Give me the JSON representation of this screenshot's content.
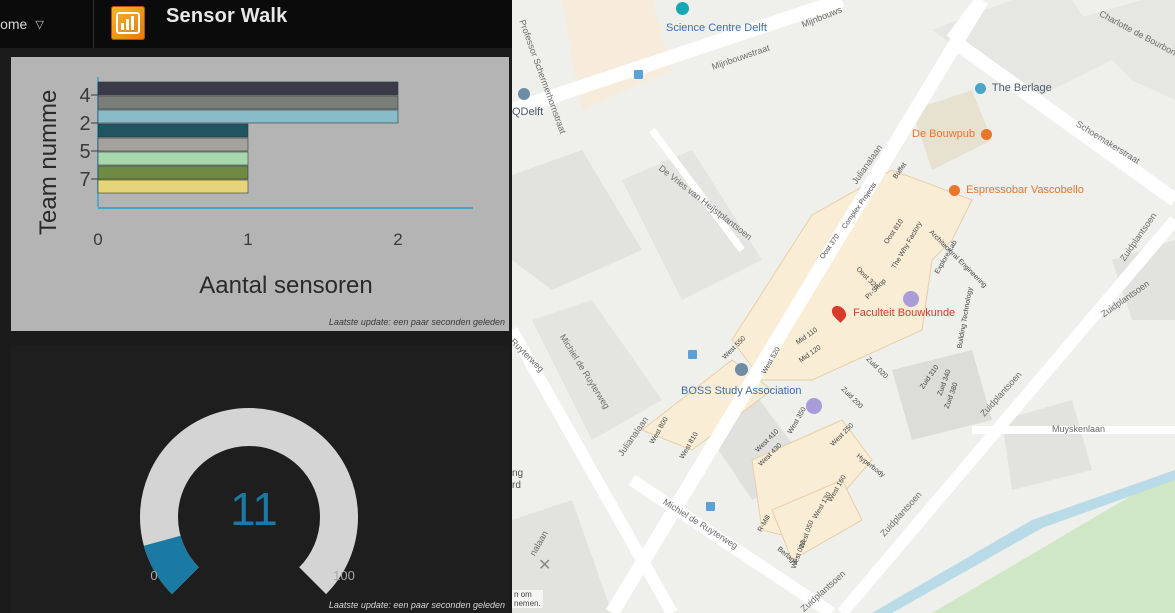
{
  "dashboard": {
    "home_label": "Home",
    "app_title": "Sensor Walk",
    "bar_chart": {
      "ylabel": "Team numme",
      "xlabel": "Aantal sensoren",
      "update_note": "Laatste update: een paar seconden geleden"
    },
    "gauge": {
      "value_text": "11",
      "min_label": "0",
      "max_label": "100",
      "update_note": "Laatste update: een paar seconden geleden"
    }
  },
  "chart_data": {
    "type": "bar",
    "orientation": "horizontal",
    "title": "",
    "xlabel": "Aantal sensoren",
    "ylabel": "Team numme",
    "xlim": [
      0,
      2.5
    ],
    "x_ticks": [
      "0",
      "1",
      "2"
    ],
    "y_tick_labels": [
      "4",
      "2",
      "5",
      "7"
    ],
    "bars": [
      {
        "value": 2,
        "color": "#3a3a48"
      },
      {
        "value": 2,
        "color": "#7a7e78"
      },
      {
        "value": 2,
        "color": "#88bcc9"
      },
      {
        "value": 1,
        "color": "#1f5461"
      },
      {
        "value": 1,
        "color": "#a4a29a"
      },
      {
        "value": 1,
        "color": "#a7d7ad"
      },
      {
        "value": 1,
        "color": "#6f8a42"
      },
      {
        "value": 1,
        "color": "#e6d47a"
      }
    ],
    "gauge_value": 11,
    "gauge_range": [
      0,
      100
    ],
    "gauge_color": "#1a7aa3"
  },
  "map": {
    "pois": {
      "science_centre": "Science Centre Delft",
      "berlage": "The Berlage",
      "bouwpub": "De Bouwpub",
      "espressobar": "Espressobar Vascobello",
      "faculteit": "Faculteit Bouwkunde",
      "boss": "BOSS Study Association",
      "qdelft": "QDelft"
    },
    "streets": {
      "mijnbouwstraat": "Mijnbouwstraat",
      "mijnbouws": "Mijnbouws",
      "schoemakerstraat": "Schoemakerstraat",
      "julianalaan_top": "Julianalaan",
      "julianalaan_bottom": "Julianalaan",
      "devries": "De Vries van Heijstplantsoen",
      "michiel_left": "Michiel de Ruyterweg",
      "michiel_bottom": "Michiel de Ruyterweg",
      "zuidplantsoen_right": "Zuidplantsoen",
      "zuidplantsoen_right2": "Zuidplantsoen",
      "zuidplantsoen_mid": "Zuidplantsoen",
      "zuidplantsoen_bottom": "Zuidplantsoen",
      "zuidplantsoen_bottom2": "Zuidplantsoen",
      "muyskenlaan": "Muyskenlaan",
      "professor": "Professor Schermerhornstraat",
      "charlotte": "Charlotte de Bourbon",
      "ruyterweg": "Ruyterweg",
      "nalaan": "nalaan"
    },
    "buildings": {
      "oost370": "Oost 370",
      "complex": "Complex Projects",
      "buffet": "Buffet",
      "oost810": "Oost 810",
      "whyfactory": "The Why Factory",
      "oost320": "Oost 320",
      "prshop": "Pr-Shop",
      "arch": "Architectural Engineering",
      "explore": "Explore Lab",
      "buildingtech": "Building Technology",
      "mid110": "Mid 110",
      "mid120": "Mid 120",
      "zuid020": "Zuid 020",
      "zuid200": "Zuid 200",
      "zuid310": "Zuid 310",
      "zuid340": "Zuid 340",
      "zuid380": "Zuid 380",
      "west550": "West 550",
      "west520": "West 520",
      "west800": "West 800",
      "west810": "West 810",
      "west350": "West 350",
      "west410": "West 410",
      "west430": "West 430",
      "west250": "West 250",
      "hyperbody": "Hyperbody",
      "west160": "West 160",
      "west130": "West 130",
      "west050": "West 050",
      "west010": "West 010",
      "rmill": "R-Mill",
      "berlage_b": "Berlage"
    },
    "edge_text": {
      "ng": "ng",
      "rd": "rd",
      "om": "n om",
      "nemen": "nemen."
    }
  }
}
